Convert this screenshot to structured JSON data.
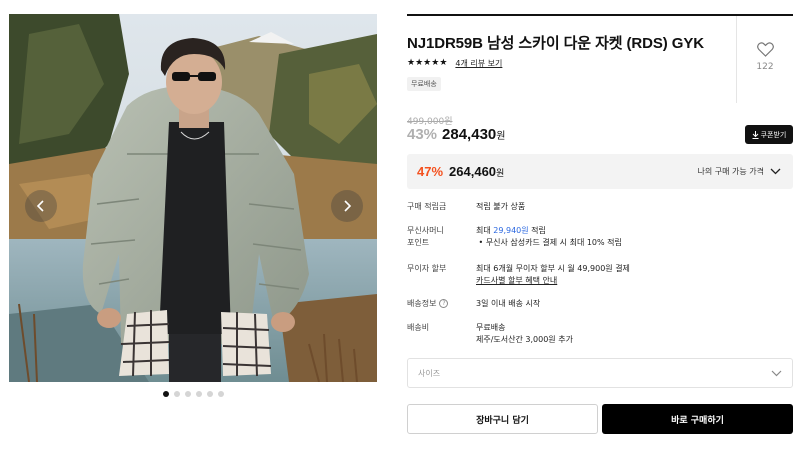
{
  "gallery": {
    "prev_icon": "chevron-left-icon",
    "next_icon": "chevron-right-icon",
    "dots_total": 6,
    "active_dot": 1
  },
  "product": {
    "title": "NJ1DR59B 남성 스카이 다운 자켓 (RDS) GYK",
    "stars": [
      "★",
      "★",
      "★",
      "★",
      "★"
    ],
    "review_link": "4개 리뷰 보기",
    "badge": "무료배송",
    "likes": "122",
    "like_icon": "heart-icon"
  },
  "price": {
    "original": "499,000원",
    "discount": "43%",
    "sale": "284,430",
    "currency": "원",
    "coupon_label": "쿠폰받기",
    "coupon_icon": "download-icon"
  },
  "my_price": {
    "discount": "47%",
    "amount": "264,460",
    "currency": "원",
    "label": "나의 구매 가능 가격",
    "toggle_icon": "chevron-down-icon"
  },
  "details": {
    "points_label": "구매 적립금",
    "points_value": "적립 불가 상품",
    "musinsa_label_1": "무신사머니",
    "musinsa_label_2": "포인트",
    "musinsa_prefix": "최대 ",
    "musinsa_amount": "29,940원",
    "musinsa_suffix": " 적립",
    "musinsa_bullet": "무신사 삼성카드 결제 시 최대 10% 적립",
    "installment_label": "무이자 할부",
    "installment_value": "최대 6개월 무이자 할부 시 월 49,900원 결제",
    "installment_link": "카드사별 할부 혜택 안내",
    "shipping_label": "배송정보",
    "shipping_value": "3일 이내 배송 시작",
    "fee_label": "배송비",
    "fee_value": "무료배송",
    "fee_note": "제주/도서산간 3,000원 추가"
  },
  "size": {
    "placeholder": "사이즈"
  },
  "actions": {
    "cart": "장바구니 담기",
    "buy": "바로 구매하기"
  }
}
